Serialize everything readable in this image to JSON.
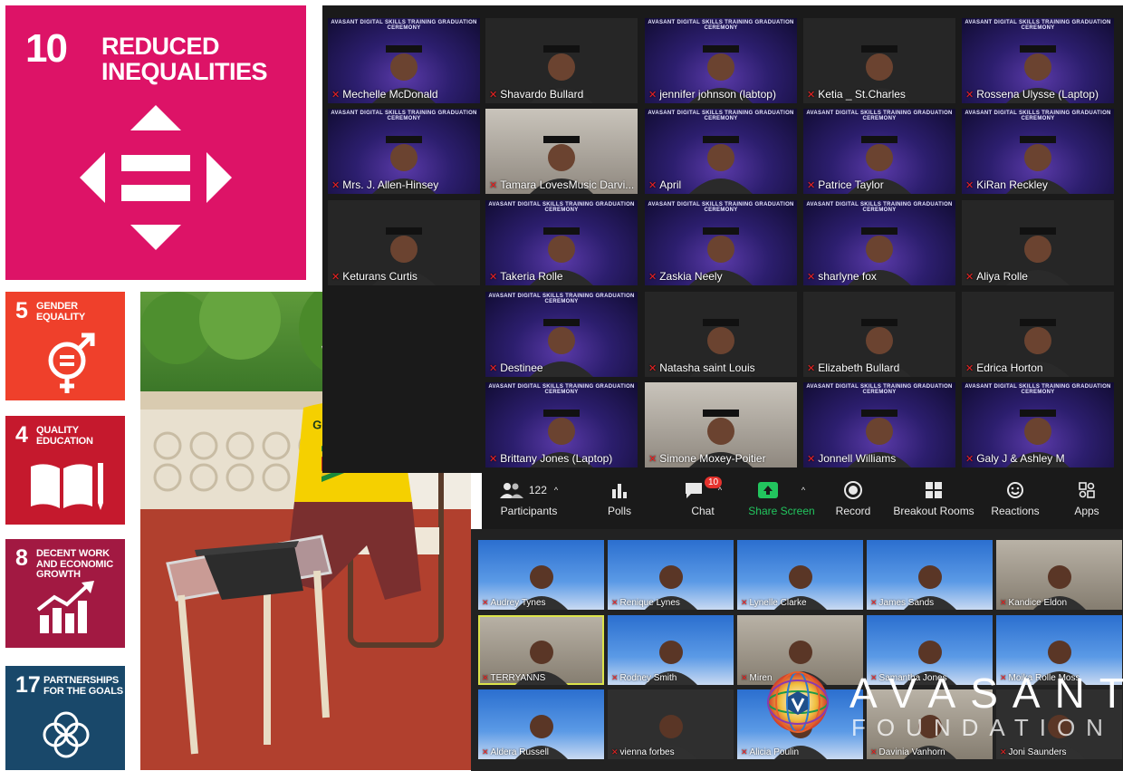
{
  "sdg": {
    "goal10": {
      "number": "10",
      "title": "REDUCED INEQUALITIES"
    },
    "goal5": {
      "number": "5",
      "title": "GENDER EQUALITY"
    },
    "goal4": {
      "number": "4",
      "title": "QUALITY EDUCATION"
    },
    "goal8": {
      "number": "8",
      "title": "DECENT WORK AND ECONOMIC GROWTH"
    },
    "goal17": {
      "number": "17",
      "title": "PARTNERSHIPS FOR THE GOALS"
    }
  },
  "photo": {
    "shirt_text": "GUYANA"
  },
  "gallery": {
    "banner": "AVASANT DIGITAL SKILLS TRAINING GRADUATION CEREMONY",
    "participants": [
      {
        "name": "Mechelle McDonald"
      },
      {
        "name": "Shavardo Bullard"
      },
      {
        "name": "jennifer johnson (labtop)"
      },
      {
        "name": "Ketia _ St.Charles"
      },
      {
        "name": "Rossena Ulysse (Laptop)"
      },
      {
        "name": "Mrs. J. Allen-Hinsey"
      },
      {
        "name": "Tamara LovesMusic Darvi..."
      },
      {
        "name": "April"
      },
      {
        "name": "Patrice Taylor"
      },
      {
        "name": "KiRan Reckley"
      },
      {
        "name": "Keturans Curtis"
      },
      {
        "name": "Takeria Rolle"
      },
      {
        "name": "Zaskia Neely"
      },
      {
        "name": "sharlyne fox"
      },
      {
        "name": "Aliya Rolle"
      },
      {
        "name": "Destinee"
      },
      {
        "name": "Natasha saint Louis"
      },
      {
        "name": "Elizabeth Bullard"
      },
      {
        "name": "Edrica Horton"
      },
      {
        "name": "Brittany Jones (Laptop)"
      },
      {
        "name": "Simone Moxey-Poitier"
      },
      {
        "name": "Jonnell Williams"
      },
      {
        "name": "Galy J & Ashley M"
      }
    ]
  },
  "toolbar": {
    "participants_label": "Participants",
    "participants_count": "122",
    "polls_label": "Polls",
    "chat_label": "Chat",
    "chat_badge": "10",
    "share_label": "Share Screen",
    "record_label": "Record",
    "breakout_label": "Breakout Rooms",
    "reactions_label": "Reactions",
    "apps_label": "Apps"
  },
  "gallery2": {
    "participants": [
      {
        "name": "Audrey Tynes"
      },
      {
        "name": "Renique Lynes"
      },
      {
        "name": "Lynelle Clarke"
      },
      {
        "name": "James Sands"
      },
      {
        "name": "Kandice Eldon"
      },
      {
        "name": "TERRYANNS"
      },
      {
        "name": "Rodney Smith"
      },
      {
        "name": "Miren"
      },
      {
        "name": "Samantha Jones"
      },
      {
        "name": "Moika Rolle Moss"
      },
      {
        "name": "Aldera Russell"
      },
      {
        "name": "vienna forbes"
      },
      {
        "name": "Alicia Poulin"
      },
      {
        "name": "Davinia Vanhorn"
      },
      {
        "name": "Joni Saunders"
      }
    ]
  },
  "brand": {
    "word": "AVASANT",
    "sub": "FOUNDATION"
  },
  "colors": {
    "sdg10": "#dd1367",
    "sdg5": "#ef402b",
    "sdg4": "#c5192d",
    "sdg8": "#a21942",
    "sdg17": "#19486a",
    "share_green": "#22c55e",
    "chat_badge": "#e5322d"
  }
}
